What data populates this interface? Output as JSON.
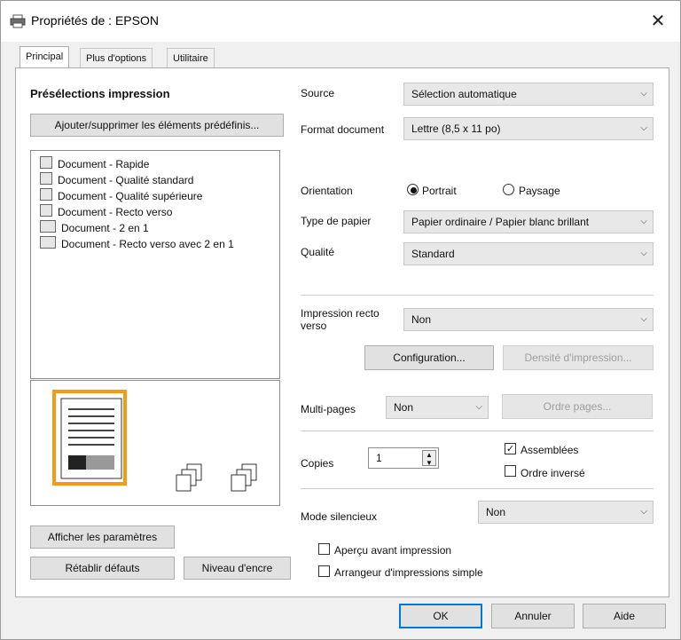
{
  "window": {
    "title": "Propriétés de : EPSON",
    "close": "✕"
  },
  "tabs": [
    {
      "label": "Principal"
    },
    {
      "label": "Plus d'options"
    },
    {
      "label": "Utilitaire"
    }
  ],
  "presets": {
    "heading": "Présélections impression",
    "add_button": "Ajouter/supprimer les éléments prédéfinis...",
    "items": [
      {
        "label": "Document - Rapide"
      },
      {
        "label": "Document - Qualité standard"
      },
      {
        "label": "Document - Qualité supérieure"
      },
      {
        "label": "Document - Recto verso"
      },
      {
        "label": "Document - 2 en 1"
      },
      {
        "label": "Document - Recto verso avec 2 en 1"
      }
    ]
  },
  "left_buttons": {
    "show_settings": "Afficher les paramètres",
    "reset": "Rétablir défauts",
    "ink": "Niveau d'encre"
  },
  "form": {
    "source": {
      "label": "Source",
      "value": "Sélection automatique"
    },
    "format": {
      "label": "Format document",
      "value": "Lettre (8,5 x 11 po)"
    },
    "orientation": {
      "label": "Orientation",
      "portrait": "Portrait",
      "landscape": "Paysage",
      "selected": "Portrait"
    },
    "paper": {
      "label": "Type de papier",
      "value": "Papier ordinaire / Papier blanc brillant"
    },
    "quality": {
      "label": "Qualité",
      "value": "Standard"
    },
    "duplex": {
      "label": "Impression recto verso",
      "value": "Non",
      "config_button": "Configuration...",
      "density_button": "Densité d'impression..."
    },
    "multipage": {
      "label": "Multi-pages",
      "value": "Non",
      "order_button": "Ordre pages..."
    },
    "copies": {
      "label": "Copies",
      "value": "1",
      "collate": "Assemblées",
      "collate_checked": true,
      "reverse": "Ordre inversé",
      "reverse_checked": false
    },
    "quiet": {
      "label": "Mode silencieux",
      "value": "Non"
    },
    "preview_before": {
      "label": "Aperçu avant impression",
      "checked": false
    },
    "simple_arranger": {
      "label": "Arrangeur d'impressions simple",
      "checked": false
    }
  },
  "footer": {
    "ok": "OK",
    "cancel": "Annuler",
    "help": "Aide"
  },
  "colors": {
    "accent": "#0078d7",
    "preview_orange": "#f39c12"
  }
}
